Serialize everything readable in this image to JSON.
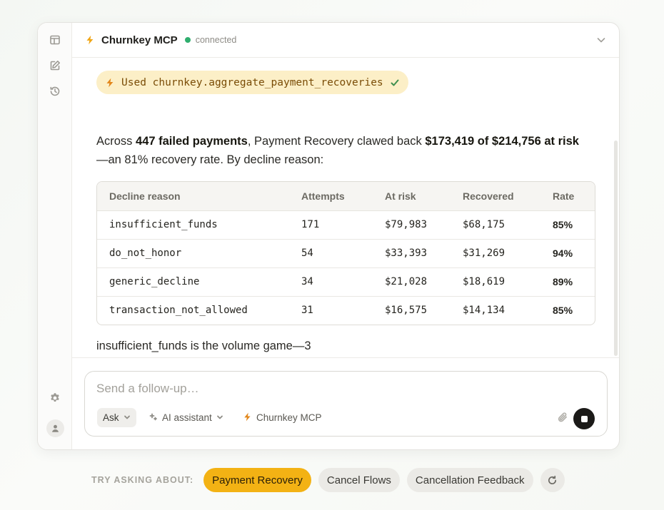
{
  "colors": {
    "accent": "#f3b214",
    "connected": "#2fae6e",
    "pill_bg": "#fcefc7"
  },
  "header": {
    "title": "Churnkey MCP",
    "status": "connected",
    "icon": "bolt-icon"
  },
  "sidebar": {
    "icons": [
      "layout-panel-icon",
      "edit-icon",
      "history-icon",
      "gear-icon",
      "user-avatar-icon"
    ]
  },
  "message": {
    "tool_pill": {
      "label": "Used churnkey.aggregate_payment_recoveries",
      "icon": "bolt-icon",
      "status_icon": "check-icon"
    },
    "summary": {
      "prefix": "Across ",
      "count": "447 failed payments",
      "middle": ", Payment Recovery clawed back ",
      "amounts": "$173,419 of $214,756 at risk",
      "suffix": "—an 81% recovery rate. By decline reason:"
    },
    "table": {
      "headers": [
        "Decline reason",
        "Attempts",
        "At risk",
        "Recovered",
        "Rate"
      ],
      "rows": [
        [
          "insufficient_funds",
          "171",
          "$79,983",
          "$68,175",
          "85%"
        ],
        [
          "do_not_honor",
          "54",
          "$33,393",
          "$31,269",
          "94%"
        ],
        [
          "generic_decline",
          "34",
          "$21,028",
          "$18,619",
          "89%"
        ],
        [
          "transaction_not_allowed",
          "31",
          "$16,575",
          "$14,134",
          "85%"
        ]
      ]
    },
    "follow_text": "insufficient_funds is the volume game—3"
  },
  "composer": {
    "placeholder": "Send a follow-up…",
    "mode": "Ask",
    "model": "AI assistant",
    "tool": "Churnkey MCP"
  },
  "suggestions": {
    "label": "TRY ASKING ABOUT:",
    "items": [
      "Payment Recovery",
      "Cancel Flows",
      "Cancellation Feedback"
    ],
    "active": "Payment Recovery"
  }
}
